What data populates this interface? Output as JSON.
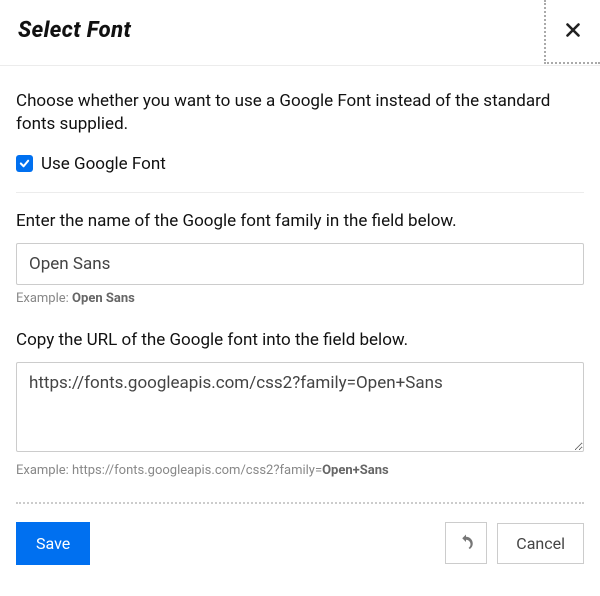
{
  "header": {
    "title": "Select Font"
  },
  "intro": "Choose whether you want to use a Google Font instead of the standard fonts supplied.",
  "checkbox": {
    "label": "Use Google Font",
    "checked": true
  },
  "fontName": {
    "label": "Enter the name of the Google font family in the field below.",
    "value": "Open Sans",
    "example_prefix": "Example: ",
    "example_bold": "Open Sans"
  },
  "fontUrl": {
    "label": "Copy the URL of the Google font into the field below.",
    "value": "https://fonts.googleapis.com/css2?family=Open+Sans",
    "example_prefix": "Example: https://fonts.googleapis.com/css2?family=",
    "example_bold": "Open+Sans"
  },
  "footer": {
    "save_label": "Save",
    "cancel_label": "Cancel"
  }
}
